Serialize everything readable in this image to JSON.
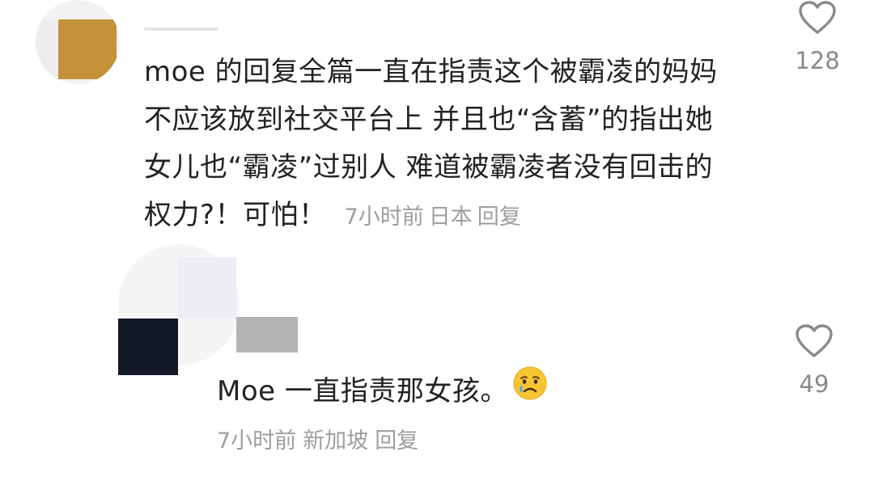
{
  "comment1": {
    "text": "moe 的回复全篇一直在指责这个被霸凌的妈妈不应该放到社交平台上 并且也“含蓄”的指出她女儿也“霸凌”过别人 难道被霸凌者没有回击的权力?！可怕！",
    "time": "7小时前",
    "location": "日本",
    "reply_label": "回复",
    "likes": "128"
  },
  "comment2": {
    "text": "Moe 一直指责那女孩。",
    "emoji_icon": "crying-face-icon",
    "time": "7小时前",
    "location": "新加坡",
    "reply_label": "回复",
    "likes": "49"
  },
  "colors": {
    "text": "#222222",
    "meta": "#9e9e9e",
    "like_count": "#8a8a8a"
  }
}
